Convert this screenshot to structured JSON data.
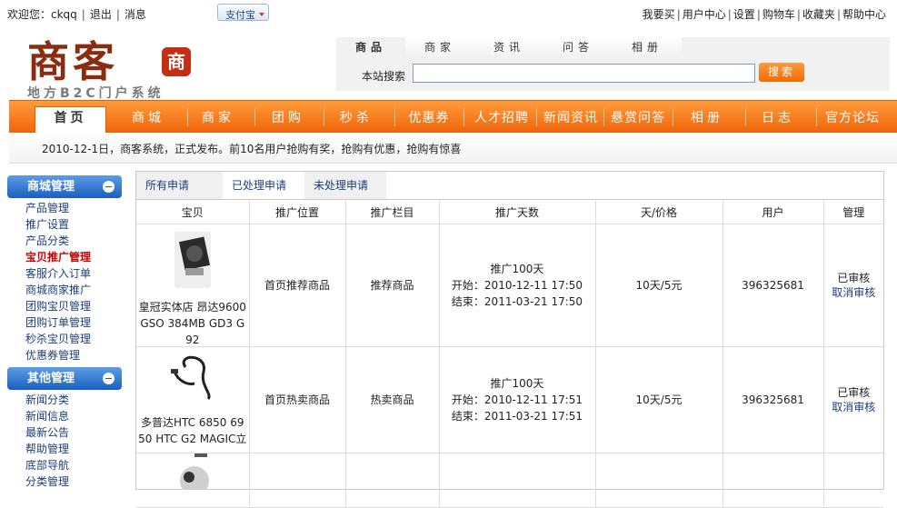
{
  "header": {
    "welcome": "欢迎您：ckqq",
    "logout": "退出",
    "messages": "消息",
    "alipay": "支付宝",
    "links": [
      "我要买",
      "用户中心",
      "设置",
      "购物车",
      "收藏夹",
      "帮助中心"
    ]
  },
  "logo": {
    "title": "商客",
    "seal": "商",
    "subtitle": "地方B2C门户系统"
  },
  "search": {
    "tabs": [
      "商品",
      "商家",
      "资讯",
      "问答",
      "相册"
    ],
    "label": "本站搜索",
    "value": "",
    "button": "搜索"
  },
  "nav": [
    "首页",
    "商城",
    "商家",
    "团购",
    "秒杀",
    "优惠券",
    "人才招聘",
    "新闻资讯",
    "悬赏问答",
    "相册",
    "日志",
    "官方论坛"
  ],
  "notice": "2010-12-1日，商客系统，正式发布。前10名用户抢购有奖，抢购有优惠，抢购有惊喜",
  "sidebar": {
    "groups": [
      {
        "title": "商城管理",
        "items": [
          "产品管理",
          "推广设置",
          "产品分类",
          "宝贝推广管理",
          "客服介入订单",
          "商城商家推广",
          "团购宝贝管理",
          "团购订单管理",
          "秒杀宝贝管理",
          "优惠券管理"
        ],
        "active": 3
      },
      {
        "title": "其他管理",
        "items": [
          "新闻分类",
          "新闻信息",
          "最新公告",
          "帮助管理",
          "底部导航",
          "分类管理"
        ]
      }
    ]
  },
  "panel": {
    "tabs": [
      "所有申请",
      "已处理申请",
      "未处理申请"
    ],
    "columns": [
      "宝贝",
      "推广位置",
      "推广栏目",
      "推广天数",
      "天/价格",
      "用户",
      "管理"
    ],
    "rows": [
      {
        "product": "皇冠实体店 昂达9600 GSO 384MB GD3 G 92",
        "position": "首页推荐商品",
        "column": "推荐商品",
        "days": "推广100天",
        "start": "开始：2010-12-11 17:50",
        "end": "结束：2011-03-21 17:50",
        "price": "10天/5元",
        "user": "396325681",
        "status": "已审核",
        "cancel": "取消审核"
      },
      {
        "product": "多普达HTC 6850 69 50 HTC G2 MAGIC立",
        "position": "首页热卖商品",
        "column": "热卖商品",
        "days": "推广100天",
        "start": "开始：2010-12-11 17:51",
        "end": "结束：2011-03-21 17:51",
        "price": "10天/5元",
        "user": "396325681",
        "status": "已审核",
        "cancel": "取消审核"
      }
    ]
  }
}
